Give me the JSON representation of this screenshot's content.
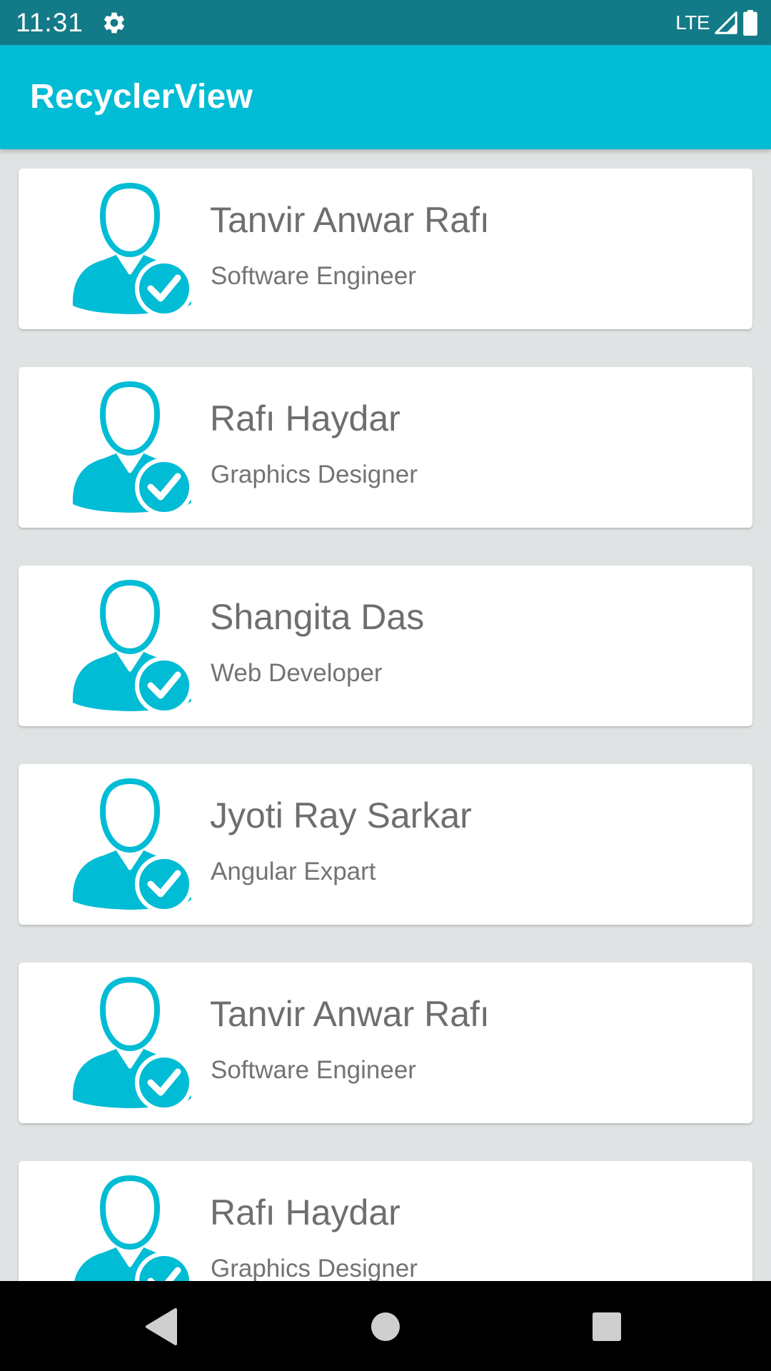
{
  "status_bar": {
    "time": "11:31",
    "network": "LTE",
    "settings_icon": "gear-icon",
    "signal_icon": "signal-icon",
    "battery_icon": "battery-icon"
  },
  "app_bar": {
    "title": "RecyclerView"
  },
  "list": {
    "items": [
      {
        "name": "Tanvir Anwar Rafı",
        "title": "Software Engineer",
        "icon": "user-verified-icon"
      },
      {
        "name": "Rafı Haydar",
        "title": "Graphics Designer",
        "icon": "user-verified-icon"
      },
      {
        "name": "Shangita Das",
        "title": "Web Developer",
        "icon": "user-verified-icon"
      },
      {
        "name": "Jyoti Ray Sarkar",
        "title": "Angular Expart",
        "icon": "user-verified-icon"
      },
      {
        "name": "Tanvir Anwar Rafı",
        "title": "Software Engineer",
        "icon": "user-verified-icon"
      },
      {
        "name": "Rafı Haydar",
        "title": "Graphics Designer",
        "icon": "user-verified-icon"
      }
    ]
  },
  "nav_bar": {
    "back_icon": "back-icon",
    "home_icon": "home-icon",
    "recents_icon": "recents-icon"
  },
  "colors": {
    "status_bar": "#137b87",
    "app_bar": "#00bcd4",
    "accent": "#00bcd4",
    "background": "#e0e3e3",
    "card": "#ffffff",
    "text": "#6e6e6e"
  }
}
